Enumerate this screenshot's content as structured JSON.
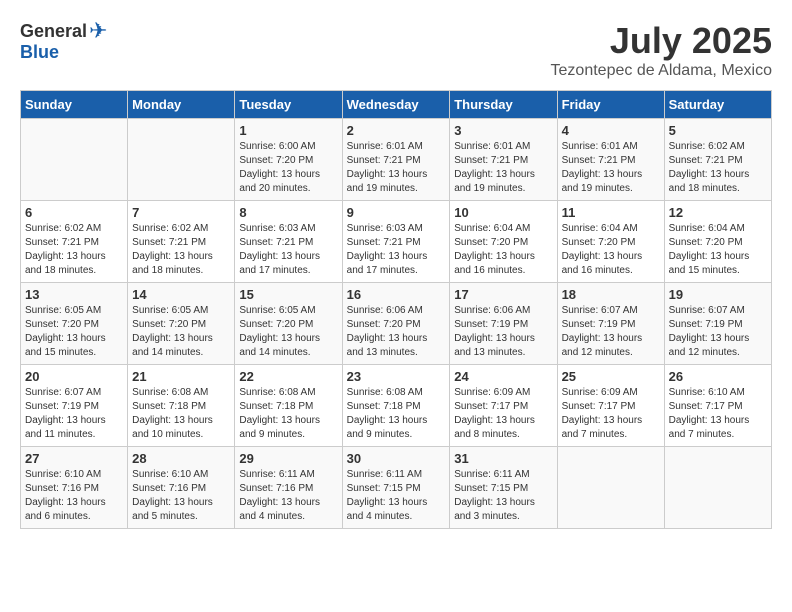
{
  "header": {
    "logo_general": "General",
    "logo_blue": "Blue",
    "month": "July 2025",
    "location": "Tezontepec de Aldama, Mexico"
  },
  "days_of_week": [
    "Sunday",
    "Monday",
    "Tuesday",
    "Wednesday",
    "Thursday",
    "Friday",
    "Saturday"
  ],
  "weeks": [
    [
      {
        "day": "",
        "info": ""
      },
      {
        "day": "",
        "info": ""
      },
      {
        "day": "1",
        "info": "Sunrise: 6:00 AM\nSunset: 7:20 PM\nDaylight: 13 hours and 20 minutes."
      },
      {
        "day": "2",
        "info": "Sunrise: 6:01 AM\nSunset: 7:21 PM\nDaylight: 13 hours and 19 minutes."
      },
      {
        "day": "3",
        "info": "Sunrise: 6:01 AM\nSunset: 7:21 PM\nDaylight: 13 hours and 19 minutes."
      },
      {
        "day": "4",
        "info": "Sunrise: 6:01 AM\nSunset: 7:21 PM\nDaylight: 13 hours and 19 minutes."
      },
      {
        "day": "5",
        "info": "Sunrise: 6:02 AM\nSunset: 7:21 PM\nDaylight: 13 hours and 18 minutes."
      }
    ],
    [
      {
        "day": "6",
        "info": "Sunrise: 6:02 AM\nSunset: 7:21 PM\nDaylight: 13 hours and 18 minutes."
      },
      {
        "day": "7",
        "info": "Sunrise: 6:02 AM\nSunset: 7:21 PM\nDaylight: 13 hours and 18 minutes."
      },
      {
        "day": "8",
        "info": "Sunrise: 6:03 AM\nSunset: 7:21 PM\nDaylight: 13 hours and 17 minutes."
      },
      {
        "day": "9",
        "info": "Sunrise: 6:03 AM\nSunset: 7:21 PM\nDaylight: 13 hours and 17 minutes."
      },
      {
        "day": "10",
        "info": "Sunrise: 6:04 AM\nSunset: 7:20 PM\nDaylight: 13 hours and 16 minutes."
      },
      {
        "day": "11",
        "info": "Sunrise: 6:04 AM\nSunset: 7:20 PM\nDaylight: 13 hours and 16 minutes."
      },
      {
        "day": "12",
        "info": "Sunrise: 6:04 AM\nSunset: 7:20 PM\nDaylight: 13 hours and 15 minutes."
      }
    ],
    [
      {
        "day": "13",
        "info": "Sunrise: 6:05 AM\nSunset: 7:20 PM\nDaylight: 13 hours and 15 minutes."
      },
      {
        "day": "14",
        "info": "Sunrise: 6:05 AM\nSunset: 7:20 PM\nDaylight: 13 hours and 14 minutes."
      },
      {
        "day": "15",
        "info": "Sunrise: 6:05 AM\nSunset: 7:20 PM\nDaylight: 13 hours and 14 minutes."
      },
      {
        "day": "16",
        "info": "Sunrise: 6:06 AM\nSunset: 7:20 PM\nDaylight: 13 hours and 13 minutes."
      },
      {
        "day": "17",
        "info": "Sunrise: 6:06 AM\nSunset: 7:19 PM\nDaylight: 13 hours and 13 minutes."
      },
      {
        "day": "18",
        "info": "Sunrise: 6:07 AM\nSunset: 7:19 PM\nDaylight: 13 hours and 12 minutes."
      },
      {
        "day": "19",
        "info": "Sunrise: 6:07 AM\nSunset: 7:19 PM\nDaylight: 13 hours and 12 minutes."
      }
    ],
    [
      {
        "day": "20",
        "info": "Sunrise: 6:07 AM\nSunset: 7:19 PM\nDaylight: 13 hours and 11 minutes."
      },
      {
        "day": "21",
        "info": "Sunrise: 6:08 AM\nSunset: 7:18 PM\nDaylight: 13 hours and 10 minutes."
      },
      {
        "day": "22",
        "info": "Sunrise: 6:08 AM\nSunset: 7:18 PM\nDaylight: 13 hours and 9 minutes."
      },
      {
        "day": "23",
        "info": "Sunrise: 6:08 AM\nSunset: 7:18 PM\nDaylight: 13 hours and 9 minutes."
      },
      {
        "day": "24",
        "info": "Sunrise: 6:09 AM\nSunset: 7:17 PM\nDaylight: 13 hours and 8 minutes."
      },
      {
        "day": "25",
        "info": "Sunrise: 6:09 AM\nSunset: 7:17 PM\nDaylight: 13 hours and 7 minutes."
      },
      {
        "day": "26",
        "info": "Sunrise: 6:10 AM\nSunset: 7:17 PM\nDaylight: 13 hours and 7 minutes."
      }
    ],
    [
      {
        "day": "27",
        "info": "Sunrise: 6:10 AM\nSunset: 7:16 PM\nDaylight: 13 hours and 6 minutes."
      },
      {
        "day": "28",
        "info": "Sunrise: 6:10 AM\nSunset: 7:16 PM\nDaylight: 13 hours and 5 minutes."
      },
      {
        "day": "29",
        "info": "Sunrise: 6:11 AM\nSunset: 7:16 PM\nDaylight: 13 hours and 4 minutes."
      },
      {
        "day": "30",
        "info": "Sunrise: 6:11 AM\nSunset: 7:15 PM\nDaylight: 13 hours and 4 minutes."
      },
      {
        "day": "31",
        "info": "Sunrise: 6:11 AM\nSunset: 7:15 PM\nDaylight: 13 hours and 3 minutes."
      },
      {
        "day": "",
        "info": ""
      },
      {
        "day": "",
        "info": ""
      }
    ]
  ]
}
